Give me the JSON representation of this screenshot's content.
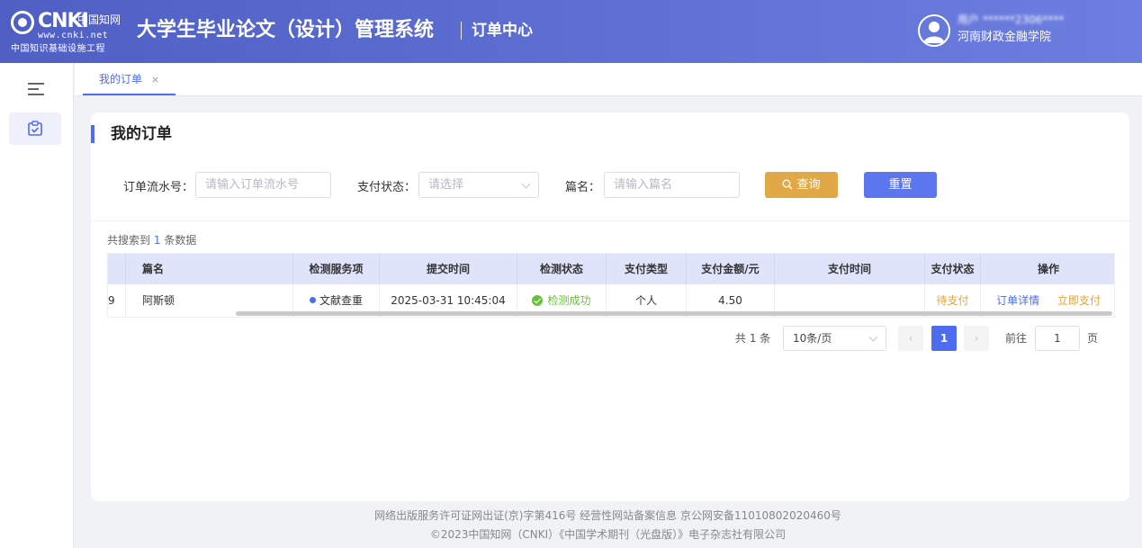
{
  "header": {
    "logo_brand": "CNKI",
    "logo_cn": "中国知网",
    "logo_url": "www.cnki.net",
    "logo_sub": "中国知识基础设施工程",
    "system_title": "大学生毕业论文（设计）管理系统",
    "section_title": "订单中心",
    "user_name": "用户 ******2306****",
    "user_org": "河南财政金融学院"
  },
  "tabs": [
    {
      "label": "我的订单",
      "close": "×"
    }
  ],
  "card": {
    "title": "我的订单"
  },
  "filters": {
    "order_no_label": "订单流水号：",
    "order_no_placeholder": "请输入订单流水号",
    "pay_status_label": "支付状态：",
    "pay_status_placeholder": "请选择",
    "title_label": "篇名：",
    "title_placeholder": "请输入篇名",
    "query_label": "查询",
    "reset_label": "重置"
  },
  "result": {
    "prefix": "共搜索到",
    "count": "1",
    "suffix": "条数据"
  },
  "table": {
    "columns": [
      "篇名",
      "检测服务项",
      "提交时间",
      "检测状态",
      "支付类型",
      "支付金额/元",
      "支付时间",
      "支付状态",
      "操作"
    ],
    "rows": [
      {
        "index": "9",
        "title": "阿斯顿",
        "service": "文献查重",
        "submit_time": "2025-03-31 10:45:04",
        "check_status": "检测成功",
        "pay_type": "个人",
        "amount": "4.50",
        "pay_time": "",
        "pay_status": "待支付",
        "action_detail": "订单详情",
        "action_pay": "立即支付"
      }
    ]
  },
  "pagination": {
    "total": "共 1 条",
    "page_size": "10条/页",
    "prev": "‹",
    "current": "1",
    "next": "›",
    "goto_label": "前往",
    "goto_value": "1",
    "page_unit": "页"
  },
  "footer": {
    "line1": "网络出版服务许可证网出证(京)字第416号  经营性网站备案信息  京公网安备11010802020460号",
    "line2": "©2023中国知网（CNKI）《中国学术期刊（光盘版）》电子杂志社有限公司"
  },
  "colors": {
    "header_start": "#4f5fc4",
    "header_end": "#6c7ee0",
    "accent": "#4f6cf0",
    "query_button": "#e1a847",
    "success": "#67c23a",
    "warning": "#e6a23c"
  },
  "icons": {
    "menu": "menu-fold-icon",
    "orders": "order-checklist-icon",
    "avatar": "user-avatar-icon",
    "search": "search-icon",
    "check": "check-circle-icon",
    "dropdown": "chevron-down-icon"
  }
}
